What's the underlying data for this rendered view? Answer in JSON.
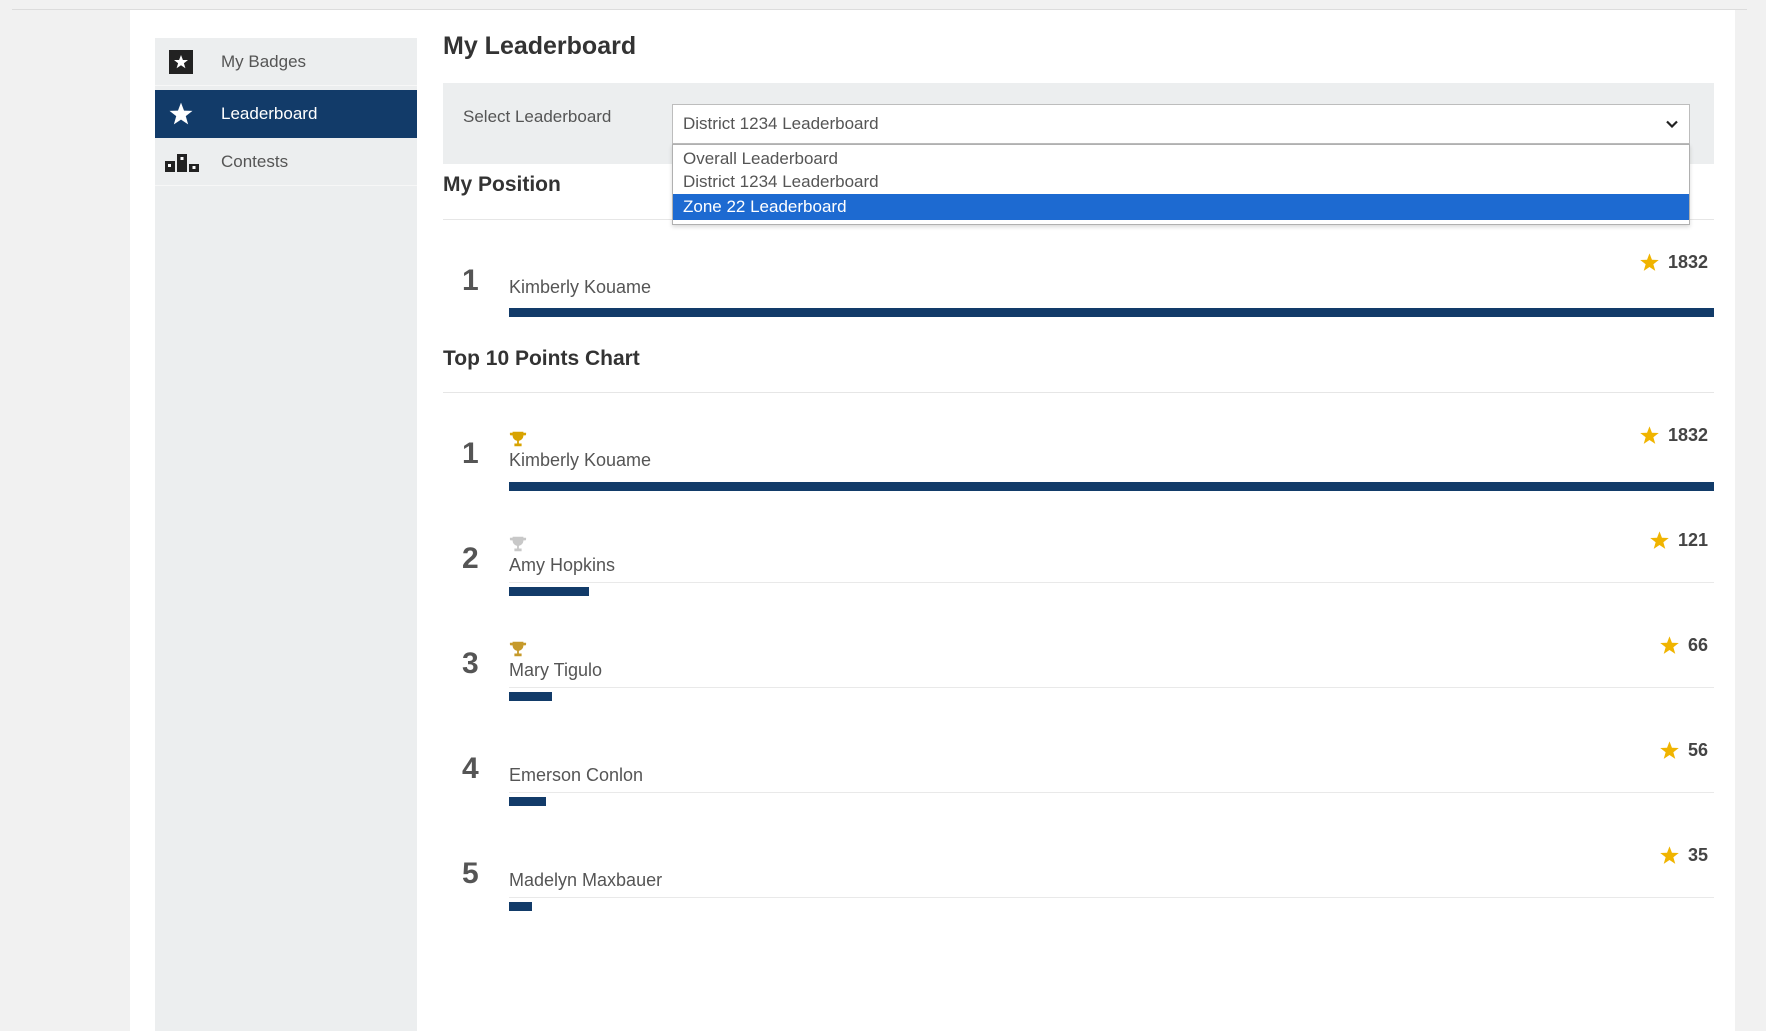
{
  "sidebar": {
    "items": [
      {
        "label": "My Badges",
        "icon": "badge-star-icon",
        "active": false
      },
      {
        "label": "Leaderboard",
        "icon": "star-icon",
        "active": true
      },
      {
        "label": "Contests",
        "icon": "podium-icon",
        "active": false
      }
    ]
  },
  "main": {
    "title": "My Leaderboard",
    "select": {
      "label": "Select Leaderboard",
      "value": "District 1234 Leaderboard",
      "options": [
        "Overall Leaderboard",
        "District 1234 Leaderboard",
        "Zone 22 Leaderboard"
      ],
      "highlighted_index": 2
    },
    "my_position": {
      "title": "My Position",
      "entry": {
        "rank": "1",
        "name": "Kimberly Kouame",
        "points": "1832",
        "fraction": 1.0
      }
    },
    "top10": {
      "title": "Top 10 Points Chart",
      "entries": [
        {
          "rank": "1",
          "name": "Kimberly Kouame",
          "points": "1832",
          "fraction": 1.0,
          "trophy": "gold"
        },
        {
          "rank": "2",
          "name": "Amy Hopkins",
          "points": "121",
          "fraction": 0.066,
          "trophy": "silver"
        },
        {
          "rank": "3",
          "name": "Mary Tigulo",
          "points": "66",
          "fraction": 0.036,
          "trophy": "bronze"
        },
        {
          "rank": "4",
          "name": "Emerson Conlon",
          "points": "56",
          "fraction": 0.031,
          "trophy": ""
        },
        {
          "rank": "5",
          "name": "Madelyn Maxbauer",
          "points": "35",
          "fraction": 0.019,
          "trophy": ""
        }
      ]
    }
  },
  "colors": {
    "accent_navy": "#123b69",
    "dropdown_highlight": "#1d6ad1",
    "star_gold": "#f0b400",
    "trophy_gold": "#d8a300",
    "trophy_silver": "#c8c8c8",
    "trophy_bronze": "#c69a2a"
  }
}
